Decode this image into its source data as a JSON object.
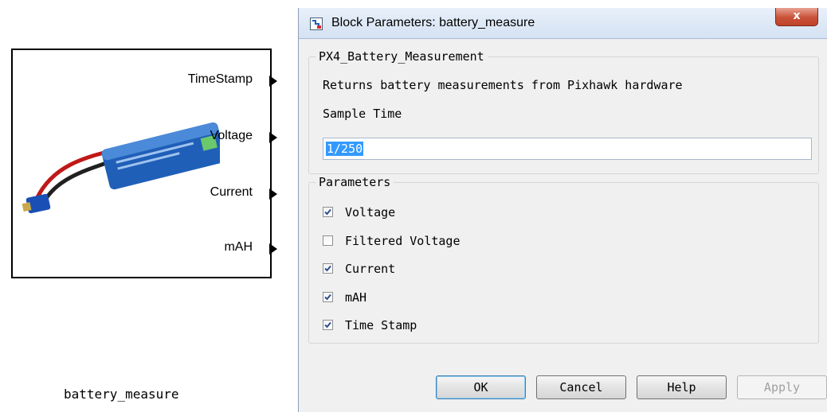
{
  "block": {
    "name": "battery_measure",
    "ports": [
      "TimeStamp",
      "Voltage",
      "Current",
      "mAH"
    ]
  },
  "dialog": {
    "title": "Block Parameters: battery_measure",
    "close_label": "x",
    "group_main_title": "PX4_Battery_Measurement",
    "description": "Returns battery measurements from Pixhawk hardware",
    "sample_time_label": "Sample Time",
    "sample_time_value": "1/250",
    "group_params_title": "Parameters",
    "checkboxes": [
      {
        "label": "Voltage",
        "checked": true
      },
      {
        "label": "Filtered Voltage",
        "checked": false
      },
      {
        "label": "Current",
        "checked": true
      },
      {
        "label": "mAH",
        "checked": true
      },
      {
        "label": "Time Stamp",
        "checked": true
      }
    ],
    "buttons": {
      "ok": "OK",
      "cancel": "Cancel",
      "help": "Help",
      "apply": "Apply"
    }
  }
}
